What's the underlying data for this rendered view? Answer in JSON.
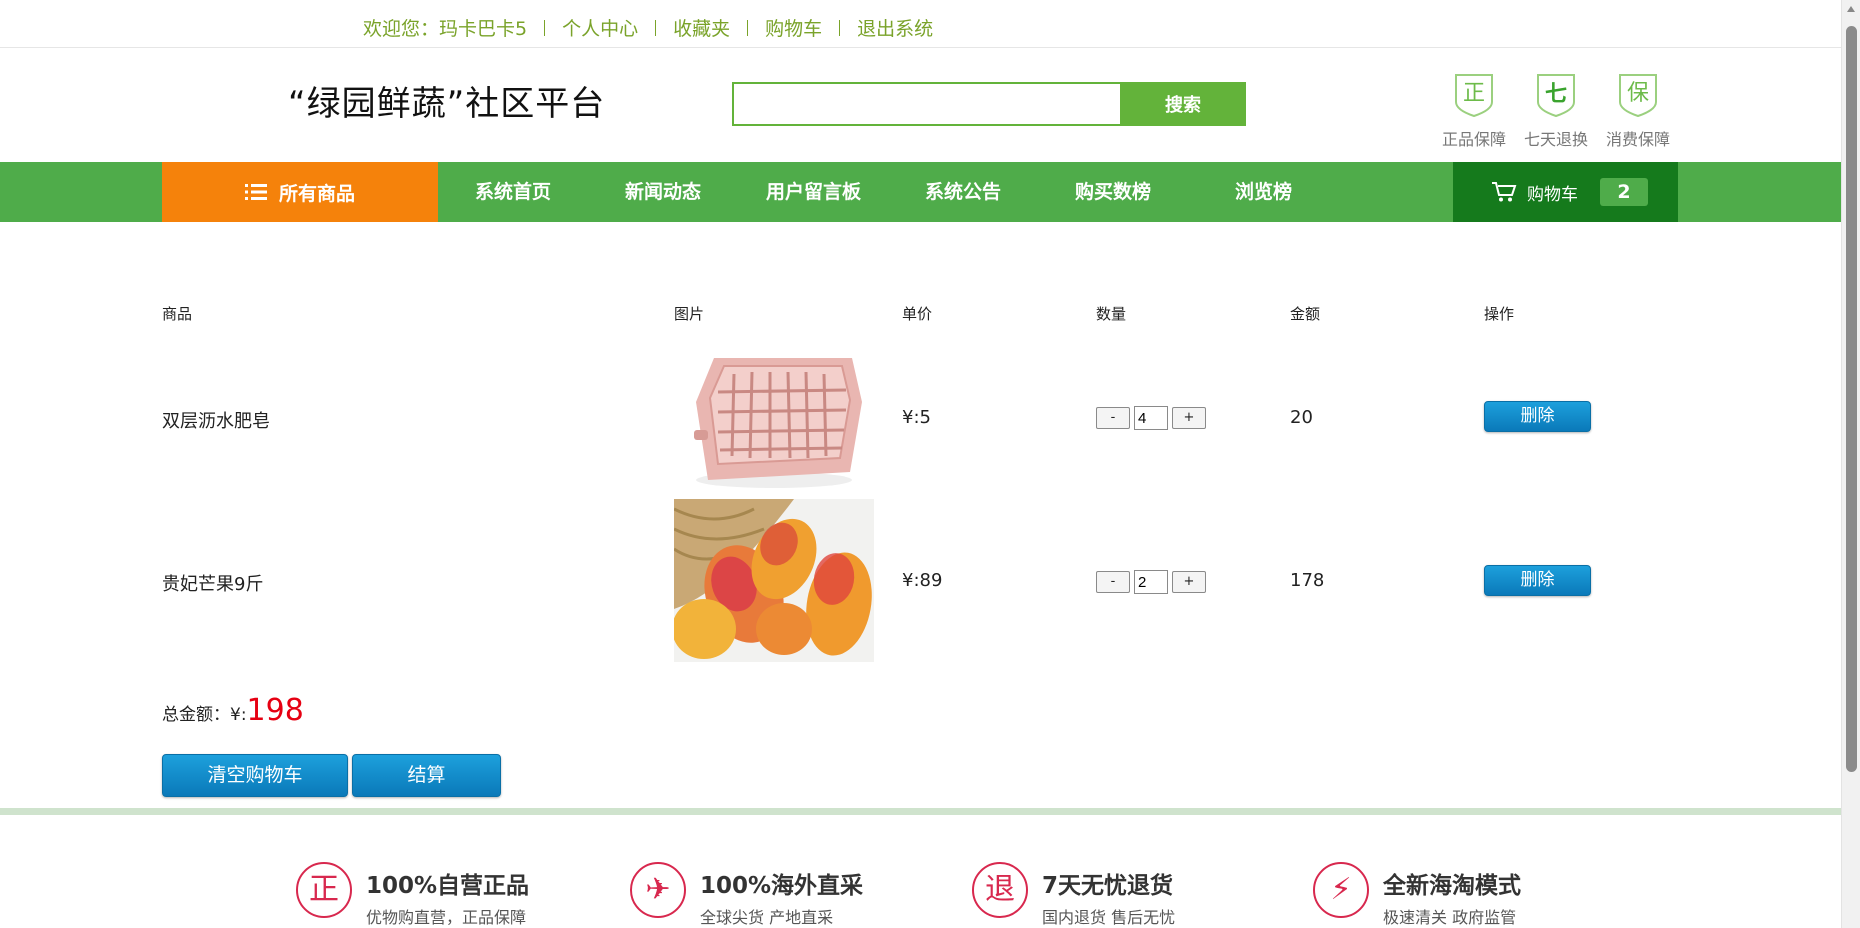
{
  "topbar": {
    "welcome": "欢迎您：玛卡巴卡5",
    "personal_center": "个人中心",
    "favorites": "收藏夹",
    "cart": "购物车",
    "logout": "退出系统"
  },
  "header": {
    "brand": "“绿园鲜蔬”社区平台",
    "search_placeholder": "",
    "search_button": "搜索",
    "guarantees": [
      {
        "glyph": "正",
        "label": "正品保障"
      },
      {
        "glyph": "七",
        "label": "七天退换"
      },
      {
        "glyph": "保",
        "label": "消费保障"
      }
    ]
  },
  "nav": {
    "all_products": "所有商品",
    "items": [
      "系统首页",
      "新闻动态",
      "用户留言板",
      "系统公告",
      "购买数榜",
      "浏览榜"
    ],
    "cart_label": "购物车",
    "cart_count": "2"
  },
  "table": {
    "headers": [
      "商品",
      "图片",
      "单价",
      "数量",
      "金额",
      "操作"
    ],
    "rows": [
      {
        "name": "双层沥水肥皂",
        "price": "¥:5",
        "qty": "4",
        "amount": "20",
        "delete": "删除"
      },
      {
        "name": "贵妃芒果9斤",
        "price": "¥:89",
        "qty": "2",
        "amount": "178",
        "delete": "删除"
      }
    ],
    "minus": "-",
    "plus": "+"
  },
  "summary": {
    "total_label": "总金额：",
    "currency": "¥:",
    "total_value": "198",
    "clear_button": "清空购物车",
    "checkout_button": "结算"
  },
  "features": [
    {
      "icon": "正",
      "title": "100%自营正品",
      "sub": "优物购直营，正品保障"
    },
    {
      "icon": "✈",
      "title": "100%海外直采",
      "sub": "全球尖货 产地直采"
    },
    {
      "icon": "退",
      "title": "7天无忧退货",
      "sub": "国内退货 售后无忧"
    },
    {
      "icon": "⚡",
      "title": "全新海淘模式",
      "sub": "极速清关 政府监管"
    }
  ],
  "colors": {
    "brand_green": "#4fac4a",
    "dark_green": "#157a1c",
    "orange": "#f5820b",
    "link_green": "#7aa32a",
    "blue_button": "#0a79b9",
    "price_red": "#e60012",
    "feature_red": "#d8284e"
  }
}
